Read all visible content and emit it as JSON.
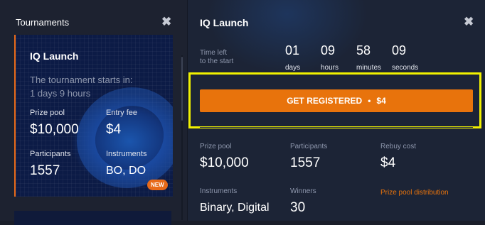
{
  "left": {
    "header": "Tournaments",
    "close": "✖",
    "card": {
      "title": "IQ Launch",
      "starts_text": "The tournament starts in:",
      "starts_days": "1 days  9 hours",
      "prize_pool_label": "Prize pool",
      "prize_pool": "$10,000",
      "entry_fee_label": "Entry fee",
      "entry_fee": "$4",
      "participants_label": "Participants",
      "participants": "1557",
      "instruments_label": "Instruments",
      "instruments": "BO, DO",
      "badge": "NEW"
    }
  },
  "right": {
    "title": "IQ Launch",
    "close": "✖",
    "time_left_line1": "Time left",
    "time_left_line2": "to the start",
    "countdown": [
      {
        "value": "01",
        "unit": "days"
      },
      {
        "value": "09",
        "unit": "hours"
      },
      {
        "value": "58",
        "unit": "minutes"
      },
      {
        "value": "09",
        "unit": "seconds"
      }
    ],
    "register": {
      "label": "GET REGISTERED",
      "sep": "•",
      "price": "$4"
    },
    "stats": {
      "prize_pool_label": "Prize pool",
      "prize_pool": "$10,000",
      "participants_label": "Participants",
      "participants": "1557",
      "rebuy_label": "Rebuy cost",
      "rebuy": "$4",
      "instruments_label": "Instruments",
      "instruments": "Binary, Digital",
      "winners_label": "Winners",
      "winners": "30",
      "distribution_link": "Prize pool distribution"
    }
  },
  "colors": {
    "accent": "#e8730c",
    "highlight": "#f1f100"
  }
}
